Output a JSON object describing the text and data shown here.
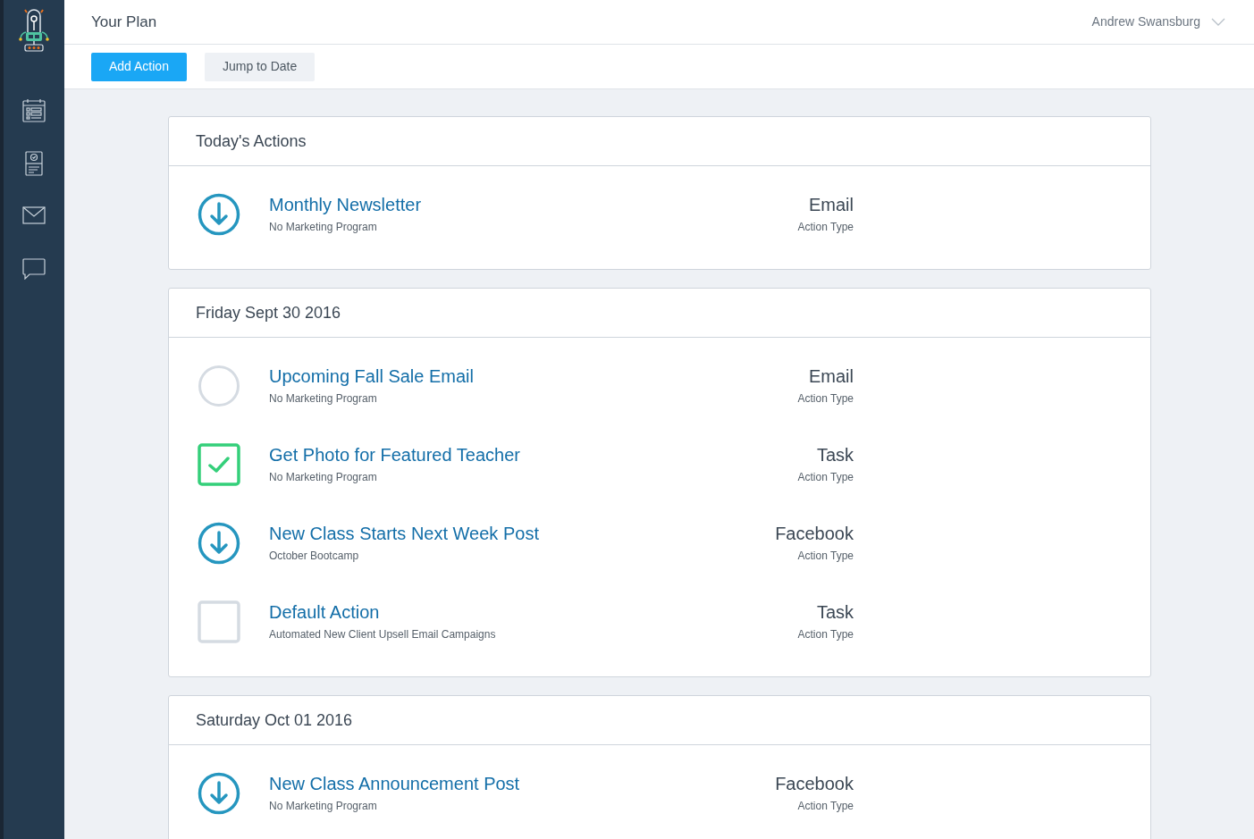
{
  "header": {
    "title": "Your Plan",
    "user": "Andrew Swansburg"
  },
  "toolbar": {
    "buttons": [
      {
        "label": "Add Action",
        "kind": "primary"
      },
      {
        "label": "Jump to Date",
        "kind": "secondary"
      }
    ]
  },
  "sections": [
    {
      "title": "Today's Actions",
      "actions": [
        {
          "kind": "scheduled",
          "title": "Monthly Newsletter",
          "program": "No Marketing Program",
          "type": "Email",
          "type_label": "Action Type"
        }
      ]
    },
    {
      "title": "Friday Sept 30 2016",
      "actions": [
        {
          "kind": "pending",
          "title": "Upcoming Fall Sale Email",
          "program": "No Marketing Program",
          "type": "Email",
          "type_label": "Action Type"
        },
        {
          "kind": "task",
          "checked": true,
          "title": "Get Photo for Featured Teacher",
          "program": "No Marketing Program",
          "type": "Task",
          "type_label": "Action Type"
        },
        {
          "kind": "scheduled",
          "title": "New Class Starts Next Week Post",
          "program": "October Bootcamp",
          "type": "Facebook",
          "type_label": "Action Type"
        },
        {
          "kind": "task",
          "checked": false,
          "title": "Default Action",
          "program": "Automated New Client Upsell Email Campaigns",
          "type": "Task",
          "type_label": "Action Type"
        }
      ]
    },
    {
      "title": "Saturday Oct 01 2016",
      "actions": [
        {
          "kind": "scheduled",
          "title": "New Class Announcement Post",
          "program": "No Marketing Program",
          "type": "Facebook",
          "type_label": "Action Type"
        }
      ]
    }
  ]
}
